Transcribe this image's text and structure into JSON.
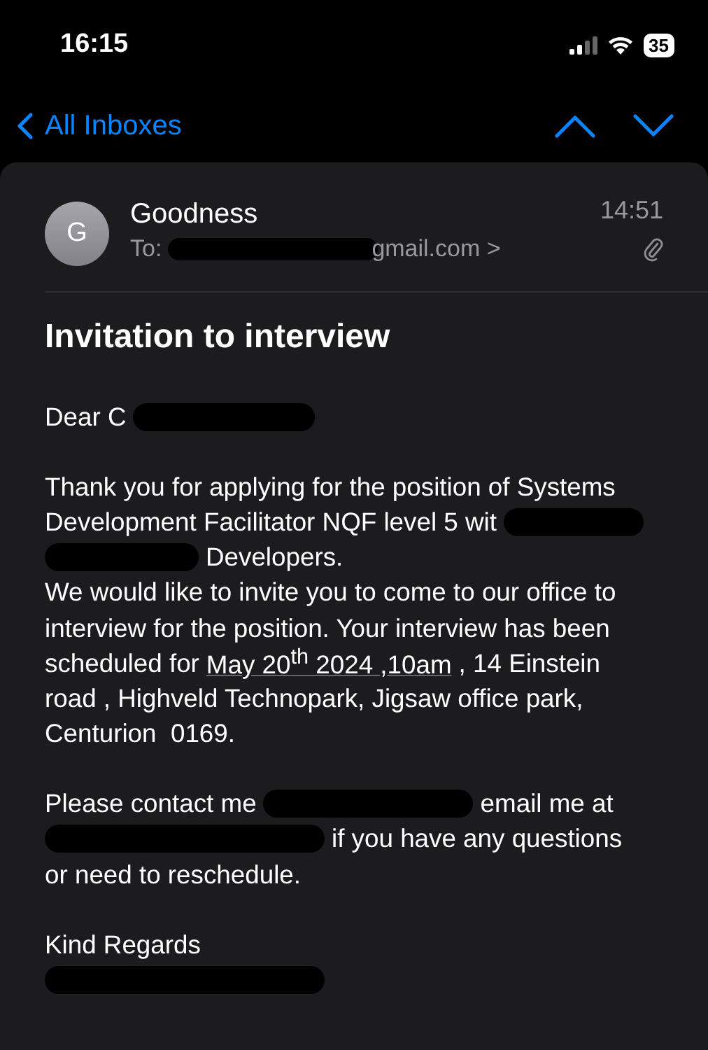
{
  "status_bar": {
    "time": "16:15",
    "battery": "35"
  },
  "nav": {
    "back_label": "All Inboxes"
  },
  "message": {
    "avatar": "G",
    "sender": "Goodness",
    "to_label": "To:",
    "to_visible": "gmail.com >",
    "time": "14:51",
    "subject": "Invitation to interview",
    "paragraphs": [
      [
        [
          {
            "kind": "text",
            "text": "Dear C"
          },
          {
            "kind": "redaction"
          }
        ]
      ],
      [
        [
          {
            "kind": "text",
            "text": "Thank you for applying for the position of Systems"
          }
        ],
        [
          {
            "kind": "text",
            "text": "Development Facilitator NQF level 5 wit"
          },
          {
            "kind": "redaction"
          }
        ],
        [
          {
            "kind": "redaction"
          },
          {
            "kind": "text",
            "text": "Developers."
          }
        ],
        [
          {
            "kind": "text",
            "text": "We would like to invite you to come to our office to"
          }
        ],
        [
          {
            "kind": "text",
            "text": "interview for the position. Your interview has been"
          }
        ],
        [
          {
            "kind": "text",
            "text": "scheduled for"
          },
          {
            "kind": "date",
            "text": "May 20$^{th}$ 2024 ,10am"
          },
          {
            "kind": "text",
            "text": ", 14 Einstein"
          }
        ],
        [
          {
            "kind": "text",
            "text": "road , Highveld Technopark, Jigsaw office park,"
          }
        ],
        [
          {
            "kind": "text",
            "text": "Centurion  0169."
          }
        ]
      ],
      [
        [
          {
            "kind": "text",
            "text": "Please contact me"
          },
          {
            "kind": "redaction"
          },
          {
            "kind": "text",
            "text": "email me at"
          }
        ],
        [
          {
            "kind": "redaction"
          },
          {
            "kind": "text",
            "text": "if you have any questions"
          }
        ],
        [
          {
            "kind": "text",
            "text": "or need to reschedule."
          }
        ]
      ],
      [
        [
          {
            "kind": "text",
            "text": "Kind Regards"
          }
        ],
        [
          {
            "kind": "redaction"
          }
        ]
      ]
    ]
  }
}
